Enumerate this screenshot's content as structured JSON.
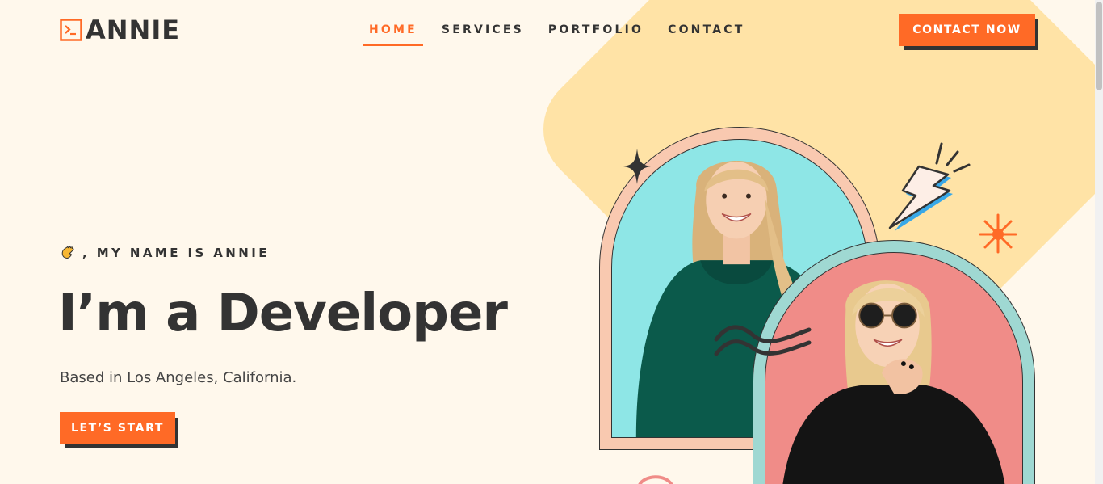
{
  "header": {
    "logo_text": "ANNIE",
    "logo_icon": "terminal-icon",
    "nav": [
      {
        "label": "HOME",
        "active": true
      },
      {
        "label": "SERVICES",
        "active": false
      },
      {
        "label": "PORTFOLIO",
        "active": false
      },
      {
        "label": "CONTACT",
        "active": false
      }
    ],
    "cta_label": "CONTACT NOW"
  },
  "hero": {
    "greeting_icon": "waving-hand-icon",
    "greeting": ", MY NAME IS ANNIE",
    "headline": "I’m a Developer",
    "subtext": "Based in Los Angeles, California.",
    "start_label": "LET’S START"
  },
  "colors": {
    "accent": "#ff6a26",
    "background": "#fff8ec",
    "diamond": "#ffe3a6",
    "text": "#333333",
    "arch_left_frame": "#f9c9b0",
    "arch_left_fill": "#8ee6e6",
    "arch_right_frame": "#9fd8d2",
    "arch_right_fill": "#f08c88"
  }
}
